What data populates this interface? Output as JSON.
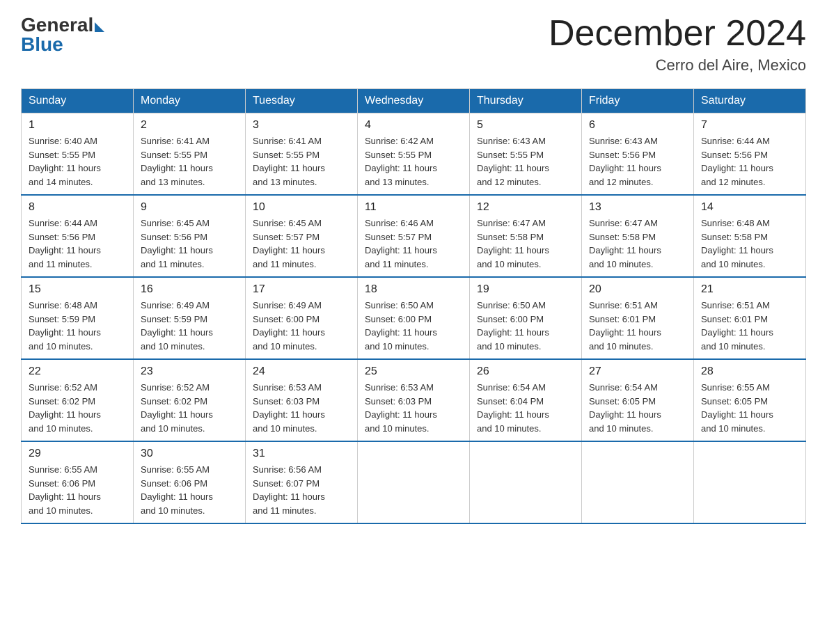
{
  "logo": {
    "general": "General",
    "blue": "Blue"
  },
  "title": "December 2024",
  "location": "Cerro del Aire, Mexico",
  "days_of_week": [
    "Sunday",
    "Monday",
    "Tuesday",
    "Wednesday",
    "Thursday",
    "Friday",
    "Saturday"
  ],
  "weeks": [
    [
      {
        "day": "1",
        "sunrise": "6:40 AM",
        "sunset": "5:55 PM",
        "daylight": "11 hours and 14 minutes."
      },
      {
        "day": "2",
        "sunrise": "6:41 AM",
        "sunset": "5:55 PM",
        "daylight": "11 hours and 13 minutes."
      },
      {
        "day": "3",
        "sunrise": "6:41 AM",
        "sunset": "5:55 PM",
        "daylight": "11 hours and 13 minutes."
      },
      {
        "day": "4",
        "sunrise": "6:42 AM",
        "sunset": "5:55 PM",
        "daylight": "11 hours and 13 minutes."
      },
      {
        "day": "5",
        "sunrise": "6:43 AM",
        "sunset": "5:55 PM",
        "daylight": "11 hours and 12 minutes."
      },
      {
        "day": "6",
        "sunrise": "6:43 AM",
        "sunset": "5:56 PM",
        "daylight": "11 hours and 12 minutes."
      },
      {
        "day": "7",
        "sunrise": "6:44 AM",
        "sunset": "5:56 PM",
        "daylight": "11 hours and 12 minutes."
      }
    ],
    [
      {
        "day": "8",
        "sunrise": "6:44 AM",
        "sunset": "5:56 PM",
        "daylight": "11 hours and 11 minutes."
      },
      {
        "day": "9",
        "sunrise": "6:45 AM",
        "sunset": "5:56 PM",
        "daylight": "11 hours and 11 minutes."
      },
      {
        "day": "10",
        "sunrise": "6:45 AM",
        "sunset": "5:57 PM",
        "daylight": "11 hours and 11 minutes."
      },
      {
        "day": "11",
        "sunrise": "6:46 AM",
        "sunset": "5:57 PM",
        "daylight": "11 hours and 11 minutes."
      },
      {
        "day": "12",
        "sunrise": "6:47 AM",
        "sunset": "5:58 PM",
        "daylight": "11 hours and 10 minutes."
      },
      {
        "day": "13",
        "sunrise": "6:47 AM",
        "sunset": "5:58 PM",
        "daylight": "11 hours and 10 minutes."
      },
      {
        "day": "14",
        "sunrise": "6:48 AM",
        "sunset": "5:58 PM",
        "daylight": "11 hours and 10 minutes."
      }
    ],
    [
      {
        "day": "15",
        "sunrise": "6:48 AM",
        "sunset": "5:59 PM",
        "daylight": "11 hours and 10 minutes."
      },
      {
        "day": "16",
        "sunrise": "6:49 AM",
        "sunset": "5:59 PM",
        "daylight": "11 hours and 10 minutes."
      },
      {
        "day": "17",
        "sunrise": "6:49 AM",
        "sunset": "6:00 PM",
        "daylight": "11 hours and 10 minutes."
      },
      {
        "day": "18",
        "sunrise": "6:50 AM",
        "sunset": "6:00 PM",
        "daylight": "11 hours and 10 minutes."
      },
      {
        "day": "19",
        "sunrise": "6:50 AM",
        "sunset": "6:00 PM",
        "daylight": "11 hours and 10 minutes."
      },
      {
        "day": "20",
        "sunrise": "6:51 AM",
        "sunset": "6:01 PM",
        "daylight": "11 hours and 10 minutes."
      },
      {
        "day": "21",
        "sunrise": "6:51 AM",
        "sunset": "6:01 PM",
        "daylight": "11 hours and 10 minutes."
      }
    ],
    [
      {
        "day": "22",
        "sunrise": "6:52 AM",
        "sunset": "6:02 PM",
        "daylight": "11 hours and 10 minutes."
      },
      {
        "day": "23",
        "sunrise": "6:52 AM",
        "sunset": "6:02 PM",
        "daylight": "11 hours and 10 minutes."
      },
      {
        "day": "24",
        "sunrise": "6:53 AM",
        "sunset": "6:03 PM",
        "daylight": "11 hours and 10 minutes."
      },
      {
        "day": "25",
        "sunrise": "6:53 AM",
        "sunset": "6:03 PM",
        "daylight": "11 hours and 10 minutes."
      },
      {
        "day": "26",
        "sunrise": "6:54 AM",
        "sunset": "6:04 PM",
        "daylight": "11 hours and 10 minutes."
      },
      {
        "day": "27",
        "sunrise": "6:54 AM",
        "sunset": "6:05 PM",
        "daylight": "11 hours and 10 minutes."
      },
      {
        "day": "28",
        "sunrise": "6:55 AM",
        "sunset": "6:05 PM",
        "daylight": "11 hours and 10 minutes."
      }
    ],
    [
      {
        "day": "29",
        "sunrise": "6:55 AM",
        "sunset": "6:06 PM",
        "daylight": "11 hours and 10 minutes."
      },
      {
        "day": "30",
        "sunrise": "6:55 AM",
        "sunset": "6:06 PM",
        "daylight": "11 hours and 10 minutes."
      },
      {
        "day": "31",
        "sunrise": "6:56 AM",
        "sunset": "6:07 PM",
        "daylight": "11 hours and 11 minutes."
      },
      null,
      null,
      null,
      null
    ]
  ],
  "labels": {
    "sunrise": "Sunrise:",
    "sunset": "Sunset:",
    "daylight": "Daylight:"
  }
}
